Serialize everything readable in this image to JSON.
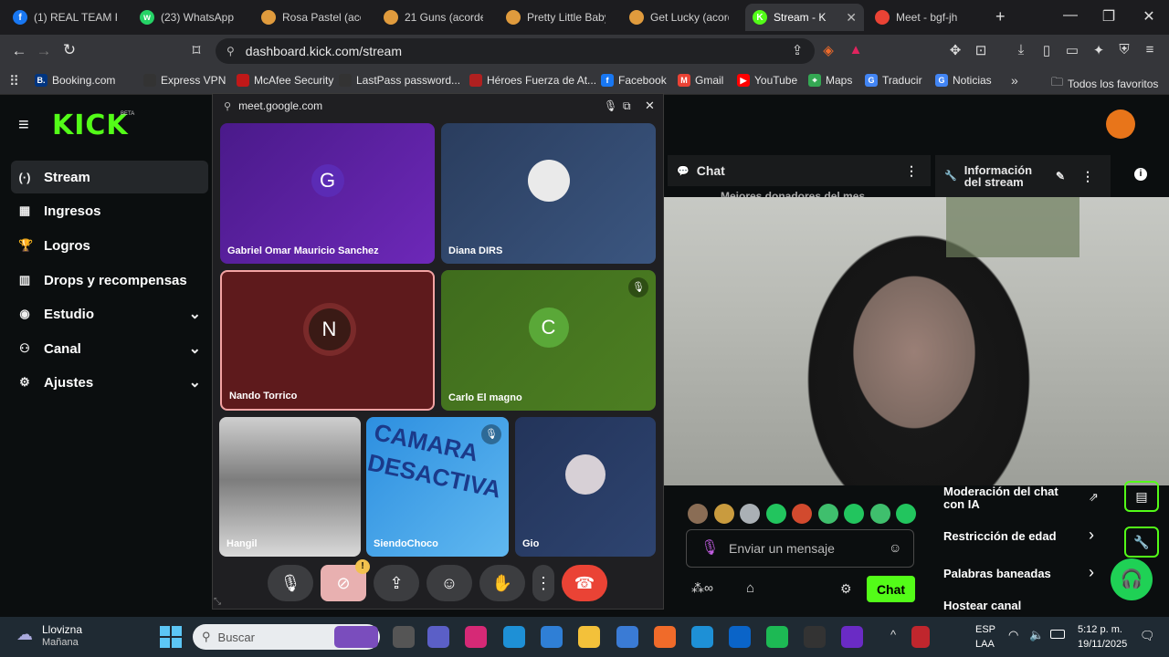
{
  "tabs": [
    {
      "label": "(1) REAL TEAM PR",
      "icon": "facebook-icon",
      "color": "#1877f2",
      "glyph": "f"
    },
    {
      "label": "(23) WhatsApp",
      "icon": "whatsapp-icon",
      "color": "#25d366",
      "glyph": "w"
    },
    {
      "label": "Rosa Pastel (acor",
      "icon": "shield-icon",
      "color": "#e09b3d",
      "glyph": ""
    },
    {
      "label": "21 Guns (acordes",
      "icon": "shield-icon",
      "color": "#e09b3d",
      "glyph": ""
    },
    {
      "label": "Pretty Little Baby",
      "icon": "shield-icon",
      "color": "#e09b3d",
      "glyph": ""
    },
    {
      "label": "Get Lucky (acorde",
      "icon": "shield-icon",
      "color": "#e09b3d",
      "glyph": ""
    },
    {
      "label": "Stream - K",
      "icon": "kick-icon",
      "color": "#53fc18",
      "glyph": "K",
      "active": true
    },
    {
      "label": "Meet - bgf-jh",
      "icon": "meet-icon",
      "color": "#ea4335",
      "glyph": ""
    }
  ],
  "address": {
    "url": "dashboard.kick.com/stream",
    "brave_count": "3"
  },
  "bookmarks": [
    {
      "label": "Booking.com",
      "color": "#003580",
      "glyph": "B."
    },
    {
      "label": "Express VPN",
      "color": "#333",
      "glyph": ""
    },
    {
      "label": "McAfee Security",
      "color": "#c01818",
      "glyph": ""
    },
    {
      "label": "LastPass password...",
      "color": "#333",
      "glyph": ""
    },
    {
      "label": "Héroes Fuerza de At...",
      "color": "#b02020",
      "glyph": ""
    },
    {
      "label": "Facebook",
      "color": "#1877f2",
      "glyph": "f"
    },
    {
      "label": "Gmail",
      "color": "#ea4335",
      "glyph": "M"
    },
    {
      "label": "YouTube",
      "color": "#ff0000",
      "glyph": "▶"
    },
    {
      "label": "Maps",
      "color": "#34a853",
      "glyph": "⌖"
    },
    {
      "label": "Traducir",
      "color": "#4285f4",
      "glyph": "G"
    },
    {
      "label": "Noticias",
      "color": "#4285f4",
      "glyph": "G"
    }
  ],
  "bookmarks_all": "Todos los favoritos",
  "kick": {
    "logo": "KICK",
    "beta": "BETA",
    "sidebar": [
      {
        "label": "Stream",
        "glyph": "(·)",
        "active": true
      },
      {
        "label": "Ingresos",
        "glyph": "▦"
      },
      {
        "label": "Logros",
        "glyph": "🏆"
      },
      {
        "label": "Drops y recompensas",
        "glyph": "▥"
      },
      {
        "label": "Estudio",
        "glyph": "◉",
        "chevron": true
      },
      {
        "label": "Canal",
        "glyph": "⚇",
        "chevron": true
      },
      {
        "label": "Ajustes",
        "glyph": "⚙",
        "chevron": true
      }
    ],
    "chat_title": "Chat",
    "info_title_1": "Información",
    "info_title_2": "del stream",
    "chat_behind": "Mejores donadores del mes",
    "message_placeholder": "Enviar un mensaje",
    "chat_button": "Chat",
    "mod_items": [
      "Moderación del chat",
      "con IA",
      "Restricción de edad",
      "Palabras baneadas",
      "Hostear canal"
    ]
  },
  "meet": {
    "origin": "meet.google.com",
    "participants": [
      {
        "name": "Gabriel Omar Mauricio Sanchez",
        "initial": "G"
      },
      {
        "name": "Diana DIRS",
        "initial": ""
      },
      {
        "name": "Nando Torrico",
        "initial": "N"
      },
      {
        "name": "Carlo El magno",
        "initial": "C"
      },
      {
        "name": "Hangil",
        "initial": ""
      },
      {
        "name": "SiendoChoco",
        "initial": "",
        "overlay": "CAMARA DESACTIVA"
      },
      {
        "name": "Gio",
        "initial": ""
      }
    ],
    "controls": [
      "mic-icon",
      "camera-off-icon",
      "present-icon",
      "emoji-icon",
      "raise-hand-icon",
      "more-icon",
      "end-call-icon"
    ]
  },
  "taskbar": {
    "weather_1": "Llovizna",
    "weather_2": "Mañana",
    "search_placeholder": "Buscar",
    "lang_1": "ESP",
    "lang_2": "LAA",
    "time": "5:12 p. m.",
    "date": "19/11/2025"
  }
}
